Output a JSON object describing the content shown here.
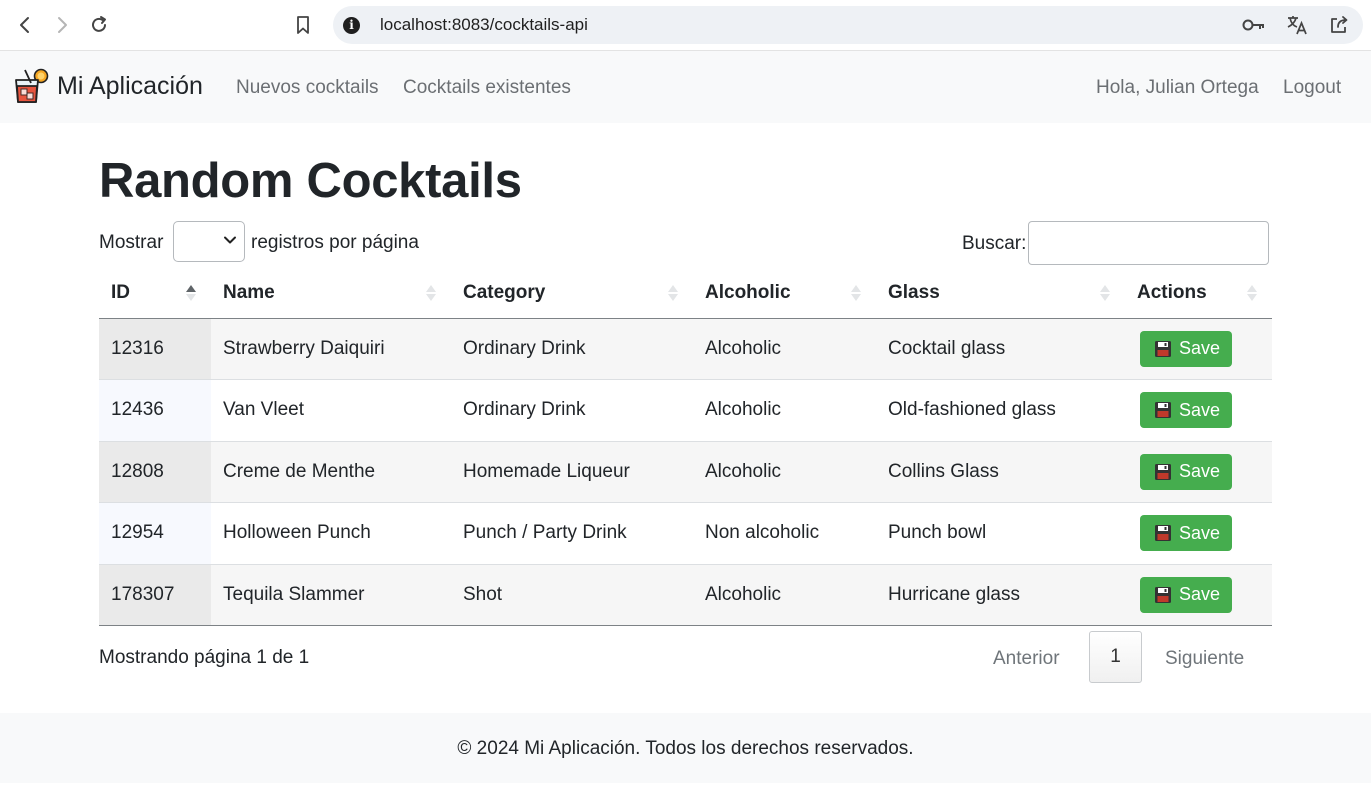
{
  "browser": {
    "url": "localhost:8083/cocktails-api"
  },
  "navbar": {
    "brand": "Mi Aplicación",
    "links": [
      "Nuevos cocktails",
      "Cocktails existentes"
    ],
    "greeting": "Hola, Julian Ortega",
    "logout": "Logout"
  },
  "main": {
    "title": "Random Cocktails",
    "length": {
      "label_before": "Mostrar",
      "value": "",
      "label_after": "registros por página"
    },
    "search": {
      "label": "Buscar:",
      "value": ""
    },
    "table": {
      "columns": [
        "ID",
        "Name",
        "Category",
        "Alcoholic",
        "Glass",
        "Actions"
      ],
      "sorted_column": "ID",
      "rows": [
        {
          "id": "12316",
          "name": "Strawberry Daiquiri",
          "category": "Ordinary Drink",
          "alcoholic": "Alcoholic",
          "glass": "Cocktail glass",
          "action": "Save"
        },
        {
          "id": "12436",
          "name": "Van Vleet",
          "category": "Ordinary Drink",
          "alcoholic": "Alcoholic",
          "glass": "Old-fashioned glass",
          "action": "Save"
        },
        {
          "id": "12808",
          "name": "Creme de Menthe",
          "category": "Homemade Liqueur",
          "alcoholic": "Alcoholic",
          "glass": "Collins Glass",
          "action": "Save"
        },
        {
          "id": "12954",
          "name": "Holloween Punch",
          "category": "Punch / Party Drink",
          "alcoholic": "Non alcoholic",
          "glass": "Punch bowl",
          "action": "Save"
        },
        {
          "id": "178307",
          "name": "Tequila Slammer",
          "category": "Shot",
          "alcoholic": "Alcoholic",
          "glass": "Hurricane glass",
          "action": "Save"
        }
      ]
    },
    "info": "Mostrando página 1 de 1",
    "pagination": {
      "previous": "Anterior",
      "current": "1",
      "next": "Siguiente"
    }
  },
  "footer": {
    "text": "© 2024 Mi Aplicación. Todos los derechos reservados."
  },
  "colors": {
    "save_button": "#45ad4e",
    "navbar_bg": "#f8f9fa",
    "nav_link": "#6b6f73"
  },
  "icons": [
    "back-arrow-icon",
    "forward-arrow-icon",
    "reload-icon",
    "bookmark-icon",
    "site-info-icon",
    "key-icon",
    "translate-icon",
    "share-icon",
    "cocktail-logo-icon",
    "floppy-disk-icon",
    "sort-icon"
  ]
}
